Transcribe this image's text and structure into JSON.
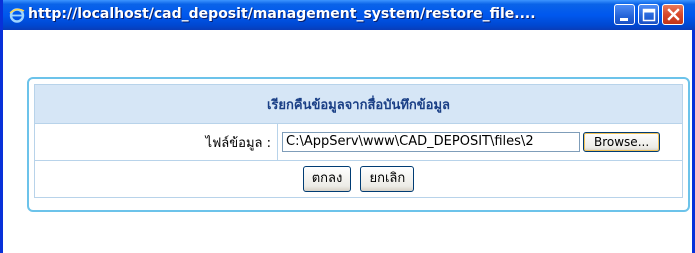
{
  "window": {
    "title": "http://localhost/cad_deposit/management_system/restore_file...."
  },
  "form": {
    "heading": "เรียกคืนข้อมูลจากสื่อบันทึกข้อมูล",
    "file_label": "ไฟล์ข้อมูล :",
    "file_value": "C:\\AppServ\\www\\CAD_DEPOSIT\\files\\2",
    "browse_label": "Browse...",
    "ok_label": "ตกลง",
    "cancel_label": "ยกเลิก"
  },
  "colors": {
    "titlebar": "#0058ee",
    "frame_border": "#6cc3ea",
    "header_bg": "#d6e6f6",
    "header_text": "#1a3f86"
  },
  "icons": {
    "window_icon": "internet-explorer-icon",
    "minimize": "minimize-icon",
    "maximize": "maximize-icon",
    "close": "close-icon"
  }
}
